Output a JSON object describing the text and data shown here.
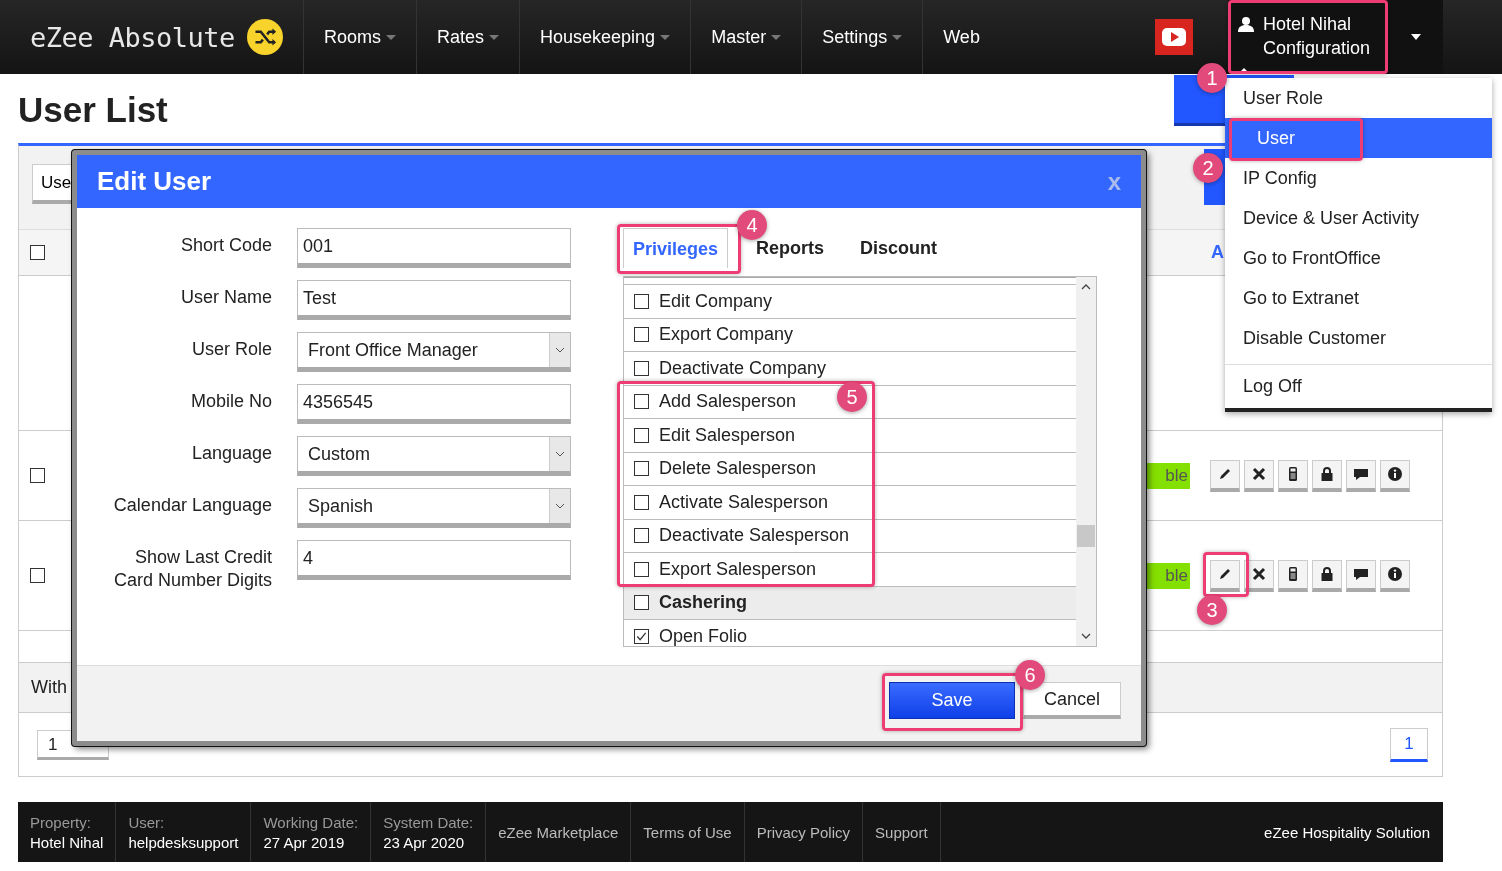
{
  "navbar": {
    "logo": "eZee Absolute",
    "menu": [
      {
        "label": "Rooms",
        "has_menu": true
      },
      {
        "label": "Rates",
        "has_menu": true
      },
      {
        "label": "Housekeeping",
        "has_menu": true
      },
      {
        "label": "Master",
        "has_menu": true
      },
      {
        "label": "Settings",
        "has_menu": true
      },
      {
        "label": "Web",
        "has_menu": false
      }
    ],
    "user_menu": {
      "name": "Hotel Nihal",
      "section": "Configuration",
      "expanded": true
    }
  },
  "page": {
    "title": "User List",
    "toolbar_button": "Use",
    "header_checked": false,
    "header_label": "A",
    "rows": [
      {
        "kind": "blank"
      },
      {
        "kind": "user",
        "checked": false,
        "status": "ble"
      },
      {
        "kind": "user",
        "checked": false,
        "status": "ble"
      },
      {
        "kind": "blank"
      }
    ],
    "footer_label": "With",
    "page_input": "1",
    "current_page": "1"
  },
  "dialog": {
    "title": "Edit User",
    "close": "x",
    "fields": [
      {
        "label": "Short Code",
        "value": "001",
        "kind": "text"
      },
      {
        "label": "User Name",
        "value": "Test",
        "kind": "text"
      },
      {
        "label": "User Role",
        "value": "Front Office Manager",
        "kind": "select"
      },
      {
        "label": "Mobile No",
        "value": "4356545",
        "kind": "text"
      },
      {
        "label": "Language",
        "value": "Custom",
        "kind": "select"
      },
      {
        "label": "Calendar Language",
        "value": "Spanish",
        "kind": "select"
      },
      {
        "label": "Show Last Credit Card Number Digits",
        "value": "4",
        "kind": "text"
      }
    ],
    "tabs": [
      {
        "label": "Privileges",
        "selected": true
      },
      {
        "label": "Reports",
        "selected": false
      },
      {
        "label": "Discount",
        "selected": false
      }
    ],
    "privileges": [
      {
        "label": "Edit Company",
        "checked": false,
        "kind": "item"
      },
      {
        "label": "Export Company",
        "checked": false,
        "kind": "item"
      },
      {
        "label": "Deactivate Company",
        "checked": false,
        "kind": "item"
      },
      {
        "label": "Add Salesperson",
        "checked": false,
        "kind": "item"
      },
      {
        "label": "Edit Salesperson",
        "checked": false,
        "kind": "item"
      },
      {
        "label": "Delete Salesperson",
        "checked": false,
        "kind": "item"
      },
      {
        "label": "Activate Salesperson",
        "checked": false,
        "kind": "item"
      },
      {
        "label": "Deactivate Salesperson",
        "checked": false,
        "kind": "item"
      },
      {
        "label": "Export Salesperson",
        "checked": false,
        "kind": "item"
      },
      {
        "label": "Cashering",
        "checked": false,
        "kind": "group"
      },
      {
        "label": "Open Folio",
        "checked": true,
        "kind": "item"
      }
    ],
    "save": "Save",
    "cancel": "Cancel"
  },
  "dropdown": {
    "items": [
      {
        "label": "User Role",
        "selected": false
      },
      {
        "label": "User",
        "selected": true
      },
      {
        "label": "IP Config",
        "selected": false
      },
      {
        "label": "Device & User Activity",
        "selected": false
      },
      {
        "label": "Go to FrontOffice",
        "selected": false
      },
      {
        "label": "Go to Extranet",
        "selected": false
      },
      {
        "label": "Disable Customer",
        "selected": false
      }
    ],
    "footer_items": [
      {
        "label": "Log Off",
        "selected": false
      }
    ]
  },
  "status_bar": {
    "cells": [
      {
        "label": "Property:",
        "value": "Hotel Nihal"
      },
      {
        "label": "User:",
        "value": "helpdesksupport"
      },
      {
        "label": "Working Date:",
        "value": "27 Apr 2019"
      },
      {
        "label": "System Date:",
        "value": "23 Apr 2020"
      }
    ],
    "links": [
      "eZee Marketplace",
      "Terms of Use",
      "Privacy Policy",
      "Support"
    ],
    "brand": "eZee Hospitality Solution"
  },
  "annotations": [
    {
      "number": "1"
    },
    {
      "number": "2"
    },
    {
      "number": "3"
    },
    {
      "number": "4"
    },
    {
      "number": "5"
    },
    {
      "number": "6"
    }
  ]
}
